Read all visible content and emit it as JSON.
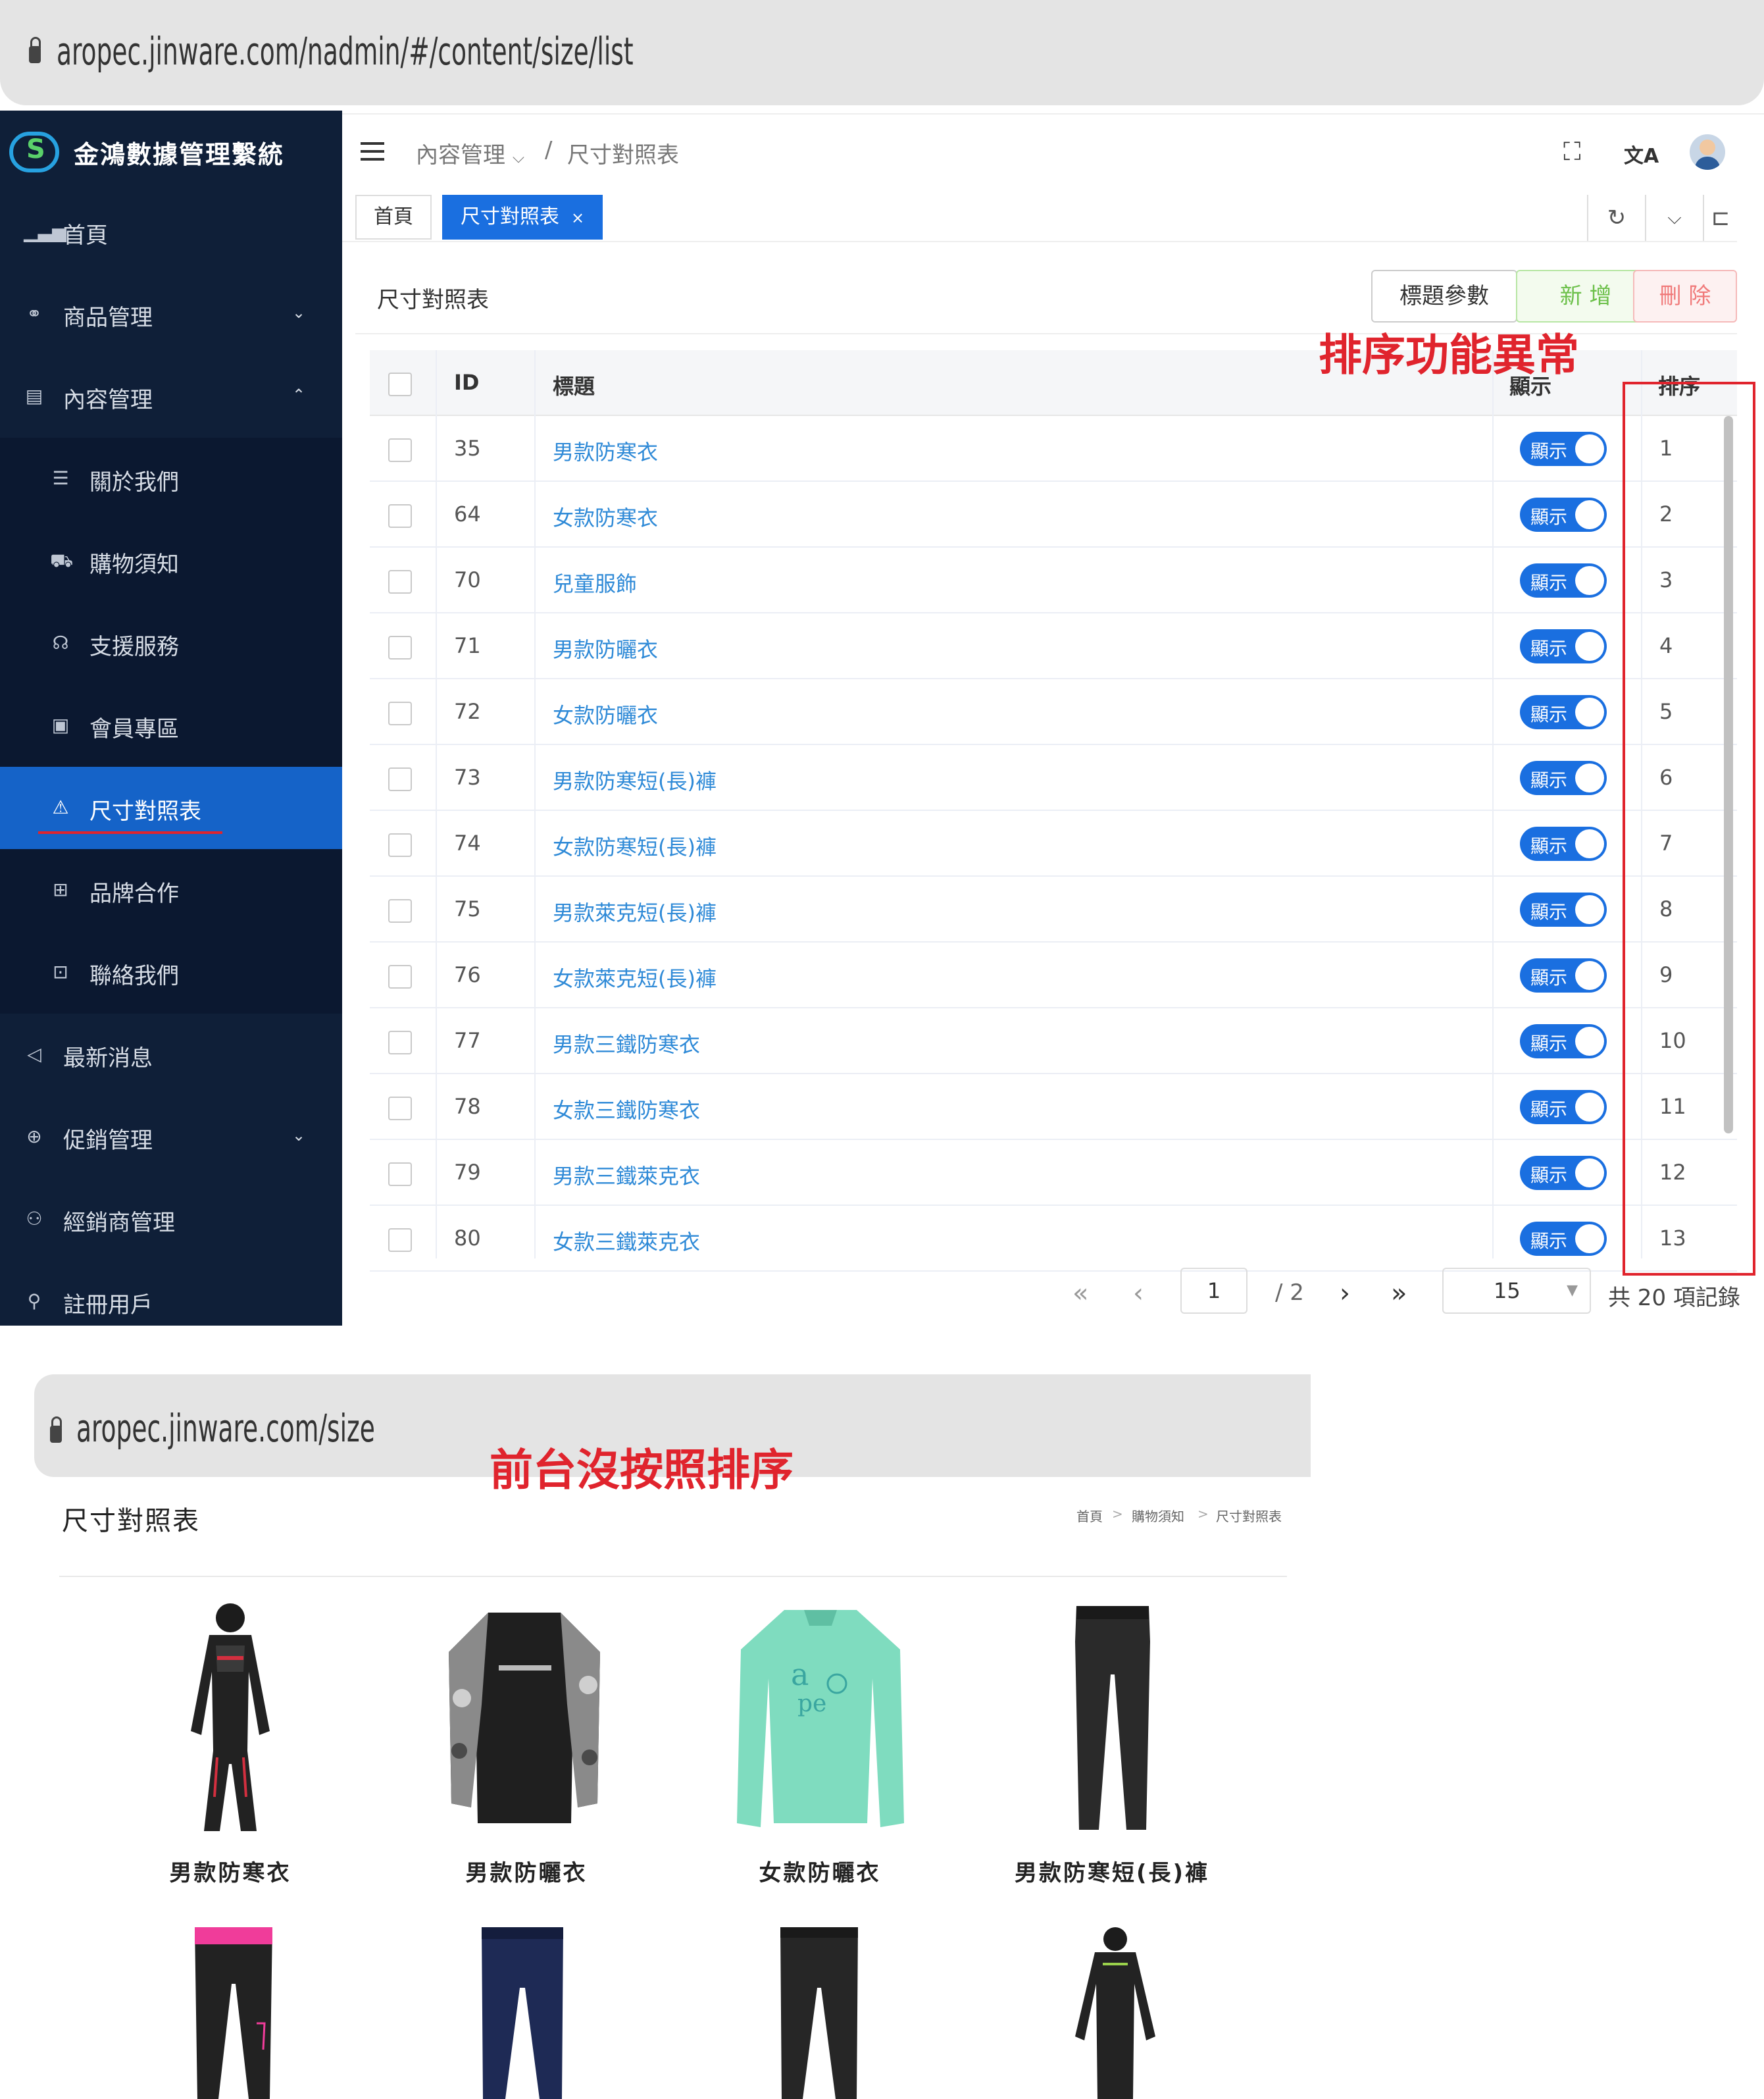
{
  "admin_url": "aropec.jinware.com/nadmin/#/content/size/list",
  "front_url": "aropec.jinware.com/size",
  "brand": {
    "title": "金鴻數據管理繫統"
  },
  "sidebar": {
    "items": [
      {
        "label": "首頁",
        "icon": "bar-chart-icon",
        "glyph": "▁▃▅"
      },
      {
        "label": "商品管理",
        "icon": "share-nodes-icon",
        "glyph": "⚭",
        "chevron": "⌄"
      },
      {
        "label": "內容管理",
        "icon": "book-icon",
        "glyph": "▤",
        "chevron": "⌃"
      },
      {
        "label": "關於我們",
        "icon": "list-icon",
        "glyph": "☰"
      },
      {
        "label": "購物須知",
        "icon": "cart-icon",
        "glyph": "⛟"
      },
      {
        "label": "支援服務",
        "icon": "headset-icon",
        "glyph": "☊"
      },
      {
        "label": "會員專區",
        "icon": "member-icon",
        "glyph": "▣"
      },
      {
        "label": "尺寸對照表",
        "icon": "triangle-icon",
        "glyph": "⚠"
      },
      {
        "label": "品牌合作",
        "icon": "brand-icon",
        "glyph": "⊞"
      },
      {
        "label": "聯絡我們",
        "icon": "contact-icon",
        "glyph": "⊡"
      },
      {
        "label": "最新消息",
        "icon": "megaphone-icon",
        "glyph": "◁"
      },
      {
        "label": "促銷管理",
        "icon": "gift-icon",
        "glyph": "⊕",
        "chevron": "⌄"
      },
      {
        "label": "經銷商管理",
        "icon": "org-icon",
        "glyph": "⚇"
      },
      {
        "label": "註冊用戶",
        "icon": "user-icon",
        "glyph": "⚲"
      }
    ]
  },
  "breadcrumb": {
    "parent": "內容管理",
    "current": "尺寸對照表",
    "sep": "/",
    "caret": "⌵"
  },
  "header_icons": {
    "fullscreen": "⛶",
    "translate": "文A"
  },
  "tabs": [
    {
      "label": "首頁"
    },
    {
      "label": "尺寸對照表",
      "close": "×"
    }
  ],
  "tab_tools": {
    "refresh": "↻",
    "dropdown": "⌵",
    "layout": "⊏"
  },
  "card": {
    "title": "尺寸對照表",
    "buttons": {
      "params": "標題參數",
      "add": "新 增",
      "delete": "刪 除"
    }
  },
  "table": {
    "headers": {
      "id": "ID",
      "title": "標題",
      "show": "顯示",
      "sort": "排序"
    },
    "switch_label": "顯示",
    "rows": [
      {
        "id": "35",
        "title": "男款防寒衣",
        "sort": "1"
      },
      {
        "id": "64",
        "title": "女款防寒衣",
        "sort": "2"
      },
      {
        "id": "70",
        "title": "兒童服飾",
        "sort": "3"
      },
      {
        "id": "71",
        "title": "男款防曬衣",
        "sort": "4"
      },
      {
        "id": "72",
        "title": "女款防曬衣",
        "sort": "5"
      },
      {
        "id": "73",
        "title": "男款防寒短(長)褲",
        "sort": "6"
      },
      {
        "id": "74",
        "title": "女款防寒短(長)褲",
        "sort": "7"
      },
      {
        "id": "75",
        "title": "男款萊克短(長)褲",
        "sort": "8"
      },
      {
        "id": "76",
        "title": "女款萊克短(長)褲",
        "sort": "9"
      },
      {
        "id": "77",
        "title": "男款三鐵防寒衣",
        "sort": "10"
      },
      {
        "id": "78",
        "title": "女款三鐵防寒衣",
        "sort": "11"
      },
      {
        "id": "79",
        "title": "男款三鐵萊克衣",
        "sort": "12"
      },
      {
        "id": "80",
        "title": "女款三鐵萊克衣",
        "sort": "13"
      }
    ]
  },
  "pagination": {
    "first": "«",
    "prev": "‹",
    "next": "›",
    "last": "»",
    "page": "1",
    "total_pages": "/ 2",
    "page_size": "15",
    "total": "共 20 項記錄",
    "caret": "▼"
  },
  "annotations": {
    "sort_error": "排序功能異常",
    "front_error": "前台沒按照排序"
  },
  "front": {
    "title": "尺寸對照表",
    "breadcrumb": {
      "home": "首頁",
      "parent": "購物須知",
      "current": "尺寸對照表",
      "sep": ">"
    },
    "products": [
      {
        "name": "男款防寒衣"
      },
      {
        "name": "男款防曬衣"
      },
      {
        "name": "女款防曬衣"
      },
      {
        "name": "男款防寒短(長)褲"
      }
    ]
  },
  "colors": {
    "sidebar": "#0f1f38",
    "accent": "#1a6fe0",
    "link": "#2f8ad7",
    "annotation": "#e0242d"
  }
}
